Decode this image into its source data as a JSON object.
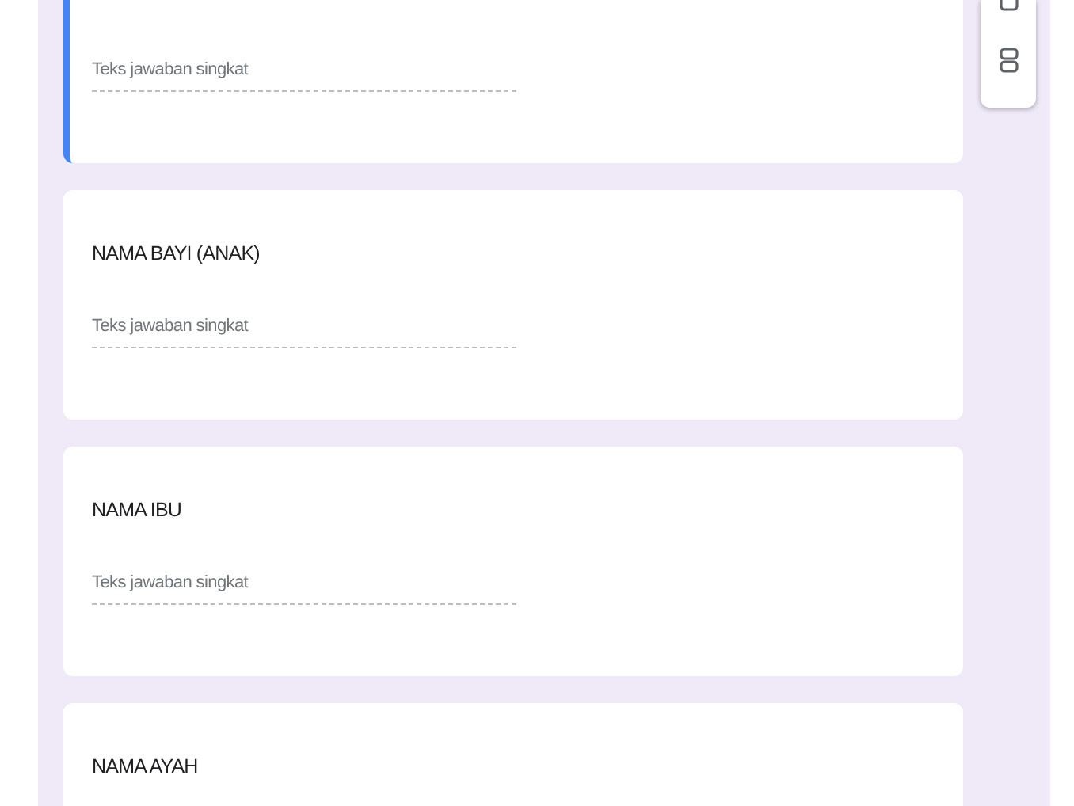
{
  "questions": [
    {
      "selected": true,
      "placeholder": "Teks jawaban singkat"
    },
    {
      "selected": false,
      "title": "NAMA BAYI (ANAK)",
      "placeholder": "Teks jawaban singkat"
    },
    {
      "selected": false,
      "title": "NAMA IBU",
      "placeholder": "Teks jawaban singkat"
    },
    {
      "selected": false,
      "title": "NAMA AYAH"
    }
  ]
}
